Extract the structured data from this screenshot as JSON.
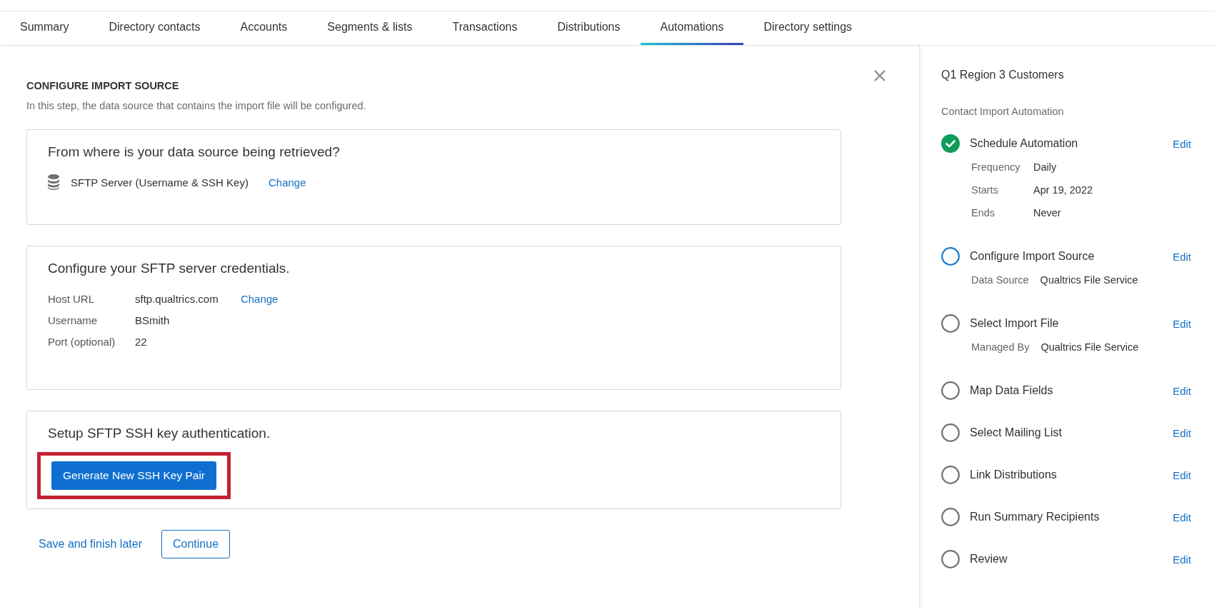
{
  "tabs": [
    {
      "label": "Summary",
      "selected": false
    },
    {
      "label": "Directory contacts",
      "selected": false
    },
    {
      "label": "Accounts",
      "selected": false
    },
    {
      "label": "Segments & lists",
      "selected": false
    },
    {
      "label": "Transactions",
      "selected": false
    },
    {
      "label": "Distributions",
      "selected": false
    },
    {
      "label": "Automations",
      "selected": true
    },
    {
      "label": "Directory settings",
      "selected": false
    }
  ],
  "main": {
    "heading": "CONFIGURE IMPORT SOURCE",
    "description": "In this step, the data source that contains the import file will be configured.",
    "source_card": {
      "title": "From where is your data source being retrieved?",
      "source": "SFTP Server (Username & SSH Key)",
      "change_link": "Change"
    },
    "credentials_card": {
      "title": "Configure your SFTP server credentials.",
      "fields": [
        {
          "label": "Host URL",
          "value": "sftp.qualtrics.com",
          "link": "Change"
        },
        {
          "label": "Username",
          "value": "BSmith"
        },
        {
          "label": "Port (optional)",
          "value": "22"
        }
      ]
    },
    "ssh_card": {
      "title": "Setup SFTP SSH key authentication.",
      "button": "Generate New SSH Key Pair",
      "highlighted": true
    },
    "save_link": "Save and finish later",
    "continue_button": "Continue"
  },
  "sidebar": {
    "title": "Q1 Region 3 Customers",
    "subtitle": "Contact Import Automation",
    "steps": [
      {
        "name": "Schedule Automation",
        "kind": "complete",
        "edit": "Edit",
        "details": [
          {
            "label": "Frequency",
            "value": "Daily"
          },
          {
            "label": "Starts",
            "value": "Apr 19, 2022"
          },
          {
            "label": "Ends",
            "value": "Never"
          }
        ]
      },
      {
        "name": "Configure Import Source",
        "kind": "current",
        "edit": "Edit",
        "details": [
          {
            "label": "Data Source",
            "value": "Qualtrics File Service"
          }
        ]
      },
      {
        "name": "Select Import File",
        "kind": "pending",
        "edit": "Edit",
        "details": [
          {
            "label": "Managed By",
            "value": "Qualtrics File Service"
          }
        ]
      },
      {
        "name": "Map Data Fields",
        "kind": "pending",
        "edit": "Edit"
      },
      {
        "name": "Select Mailing List",
        "kind": "pending",
        "edit": "Edit"
      },
      {
        "name": "Link Distributions",
        "kind": "pending",
        "edit": "Edit"
      },
      {
        "name": "Run Summary Recipients",
        "kind": "pending",
        "edit": "Edit"
      },
      {
        "name": "Review",
        "kind": "pending",
        "edit": "Edit"
      }
    ]
  }
}
